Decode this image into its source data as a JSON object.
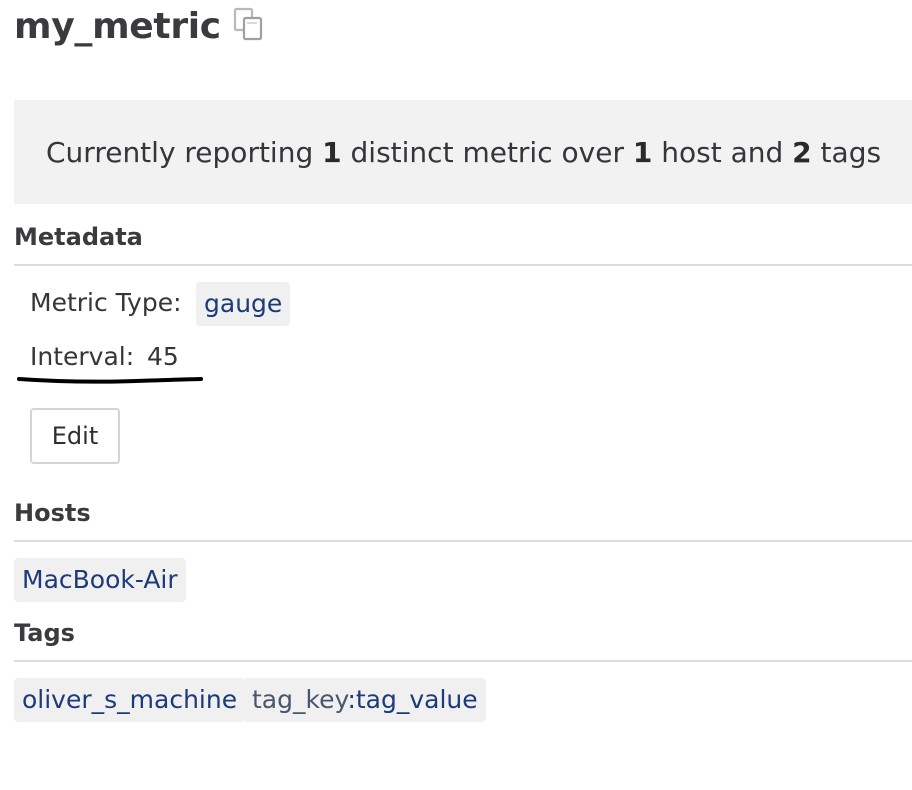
{
  "metric": {
    "name": "my_metric",
    "copy_icon": "copy-icon"
  },
  "summary": {
    "prefix": "Currently reporting ",
    "metric_count": "1",
    "mid1": " distinct metric over ",
    "host_count": "1",
    "mid2": " host and ",
    "tag_count": "2",
    "suffix": " tags"
  },
  "metadata": {
    "header": "Metadata",
    "metric_type_label": "Metric Type:",
    "metric_type_value": "gauge",
    "interval_label": "Interval:",
    "interval_value": "45",
    "edit_label": "Edit"
  },
  "hosts": {
    "header": "Hosts",
    "items": [
      "MacBook-Air"
    ]
  },
  "tags": {
    "header": "Tags",
    "items": [
      {
        "label": "oliver_s_machine"
      },
      {
        "key": "tag_key",
        "separator": ":",
        "value": "tag_value"
      }
    ]
  },
  "colors": {
    "summary_background": "#f2f2f2",
    "pill_background": "#f0f0f0",
    "pill_text": "#1d3a7a",
    "annotation_stroke": "#000000"
  }
}
